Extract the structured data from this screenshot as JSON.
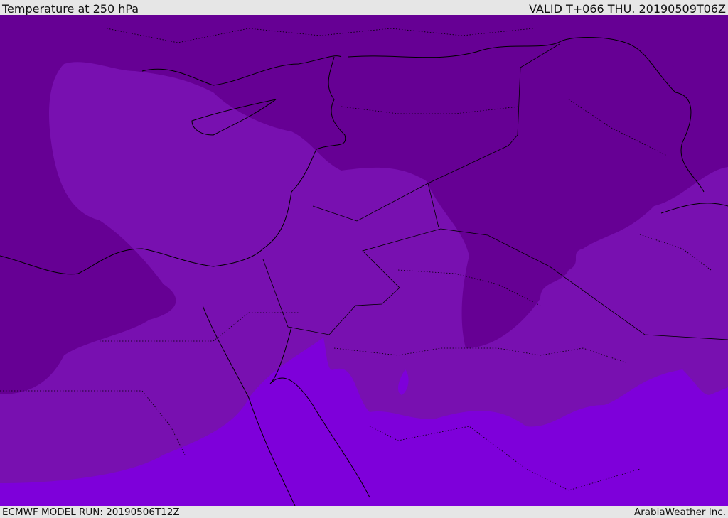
{
  "header": {
    "title": "Temperature at 250 hPa",
    "valid": "VALID T+066 THU. 20190509T06Z"
  },
  "footer": {
    "model_run": "ECMWF MODEL RUN: 20190506T12Z",
    "credit": "ArabiaWeather Inc."
  },
  "map": {
    "variable": "temperature",
    "level": "250 hPa",
    "colors": {
      "cold": "#660094",
      "mid": "#7810b0",
      "warm": "#7e00da",
      "coast": "#000000"
    }
  }
}
